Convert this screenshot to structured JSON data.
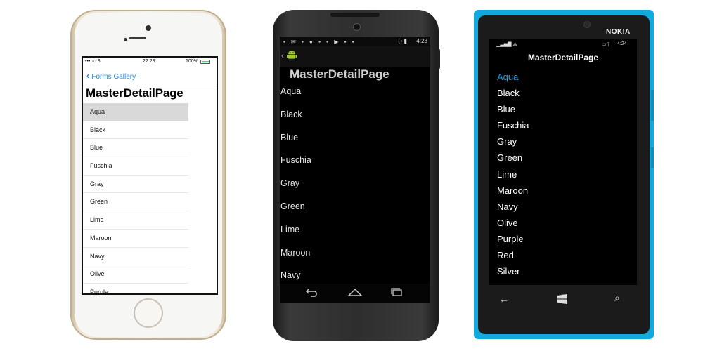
{
  "ios": {
    "status": {
      "carrier": "•••○○ 3",
      "time": "22:28",
      "battery": "100%"
    },
    "nav": {
      "back_label": "Forms Gallery"
    },
    "title": "MasterDetailPage",
    "items": [
      "Aqua",
      "Black",
      "Blue",
      "Fuschia",
      "Gray",
      "Green",
      "Lime",
      "Maroon",
      "Navy",
      "Olive",
      "Purple"
    ],
    "selected_index": 0,
    "accent": "#1a82f7"
  },
  "android": {
    "status": {
      "time": "4:23"
    },
    "title": "MasterDetailPage",
    "items": [
      "Aqua",
      "Black",
      "Blue",
      "Fuschia",
      "Gray",
      "Green",
      "Lime",
      "Maroon",
      "Navy"
    ],
    "logo_color": "#a4c639"
  },
  "nokia": {
    "brand": "NOKIA",
    "status": {
      "time": "4:24"
    },
    "title": "MasterDetailPage",
    "items": [
      "Aqua",
      "Black",
      "Blue",
      "Fuschia",
      "Gray",
      "Green",
      "Lime",
      "Maroon",
      "Navy",
      "Olive",
      "Purple",
      "Red",
      "Silver"
    ],
    "selected_index": 0,
    "accent": "#1ba1e2",
    "body_color": "#12a9dd"
  }
}
